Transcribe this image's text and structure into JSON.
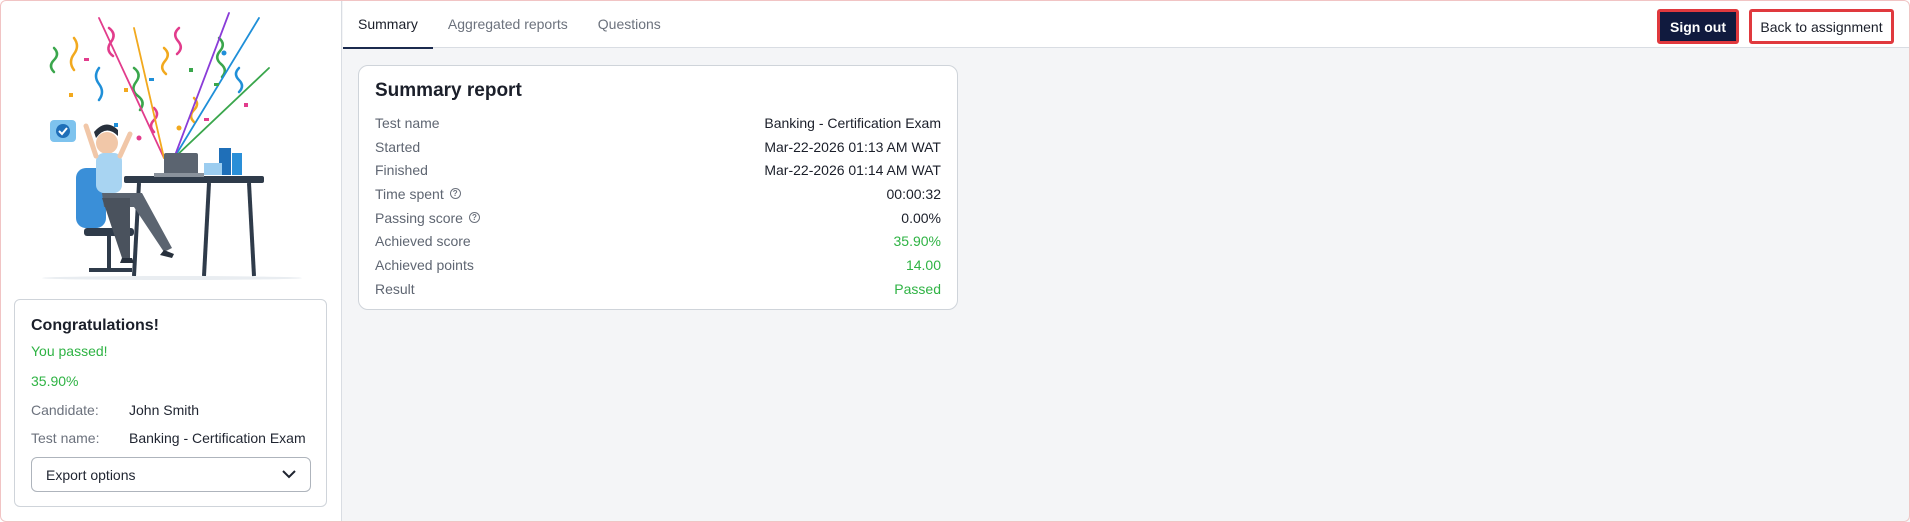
{
  "tabs": [
    {
      "label": "Summary"
    },
    {
      "label": "Aggregated reports"
    },
    {
      "label": "Questions"
    }
  ],
  "header": {
    "sign_out_label": "Sign out",
    "back_label": "Back to assignment"
  },
  "sidebar": {
    "congrats_title": "Congratulations!",
    "passed_text": "You passed!",
    "score": "35.90%",
    "candidate_label": "Candidate:",
    "candidate_value": "John Smith",
    "test_name_label": "Test name:",
    "test_name_value": "Banking - Certification Exam",
    "export_label": "Export options"
  },
  "summary": {
    "title": "Summary report",
    "rows": [
      {
        "label": "Test name",
        "value": "Banking - Certification Exam"
      },
      {
        "label": "Started",
        "value": "Mar-22-2026 01:13 AM WAT"
      },
      {
        "label": "Finished",
        "value": "Mar-22-2026 01:14 AM WAT"
      },
      {
        "label": "Time spent",
        "value": "00:00:32"
      },
      {
        "label": "Passing score",
        "value": "0.00%"
      },
      {
        "label": "Achieved score",
        "value": "35.90%"
      },
      {
        "label": "Achieved points",
        "value": "14.00"
      },
      {
        "label": "Result",
        "value": "Passed"
      }
    ]
  },
  "colors": {
    "success": "#2fb344",
    "primary_button": "#101a3e",
    "highlight_border": "#e0393e"
  }
}
